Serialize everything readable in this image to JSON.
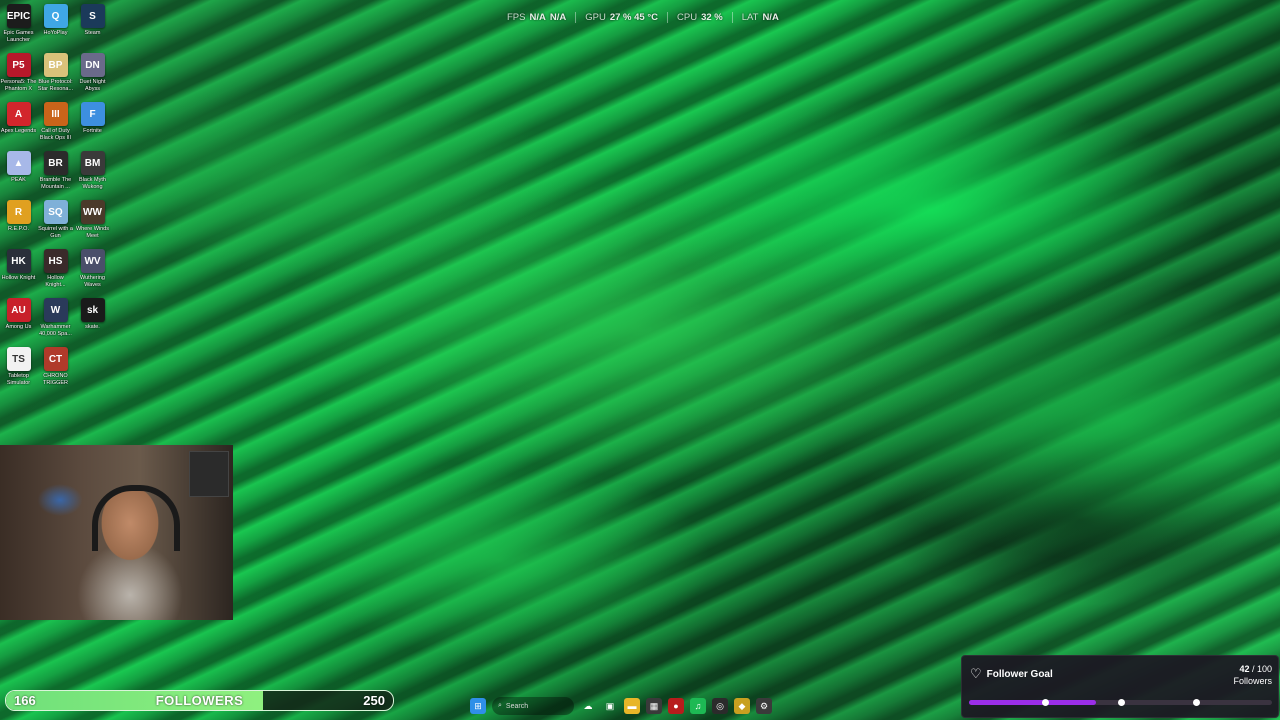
{
  "performance_overlay": {
    "fps_label": "FPS",
    "fps_value": "N/A",
    "fps_value2": "N/A",
    "gpu_label": "GPU",
    "gpu_value": "27 %  45 °C",
    "cpu_label": "CPU",
    "cpu_value": "32 %",
    "lat_label": "LAT",
    "lat_value": "N/A"
  },
  "desktop_icons": [
    {
      "name": "epic-games-launcher-icon",
      "label": "Epic Games Launcher",
      "glyph": "EPIC",
      "color": "#1c1c1c"
    },
    {
      "name": "hoyoplay-icon",
      "label": "HoYoPlay",
      "glyph": "Q",
      "color": "#3fa7e6"
    },
    {
      "name": "steam-icon",
      "label": "Steam",
      "glyph": "S",
      "color": "#1b3a5a"
    },
    {
      "name": "persona5-icon",
      "label": "Persona5: The Phantom X",
      "glyph": "P5",
      "color": "#b8182a"
    },
    {
      "name": "blue-protocol-icon",
      "label": "Blue Protocol: Star Resona...",
      "glyph": "BP",
      "color": "#d9c27a"
    },
    {
      "name": "duet-night-abyss-icon",
      "label": "Duet Night Abyss",
      "glyph": "DN",
      "color": "#6a6a8a"
    },
    {
      "name": "apex-legends-icon",
      "label": "Apex Legends",
      "glyph": "A",
      "color": "#d2262c"
    },
    {
      "name": "call-of-duty-icon",
      "label": "Call of Duty Black Ops III",
      "glyph": "III",
      "color": "#c9641a"
    },
    {
      "name": "fortnite-icon",
      "label": "Fortnite",
      "glyph": "F",
      "color": "#3d8fe0"
    },
    {
      "name": "peak-icon",
      "label": "PEAK",
      "glyph": "▲",
      "color": "#a7b8e8"
    },
    {
      "name": "bramble-icon",
      "label": "Bramble The Mountain ...",
      "glyph": "BR",
      "color": "#2b2b2b"
    },
    {
      "name": "black-myth-wukong-icon",
      "label": "Black Myth Wukong",
      "glyph": "BM",
      "color": "#3a3a3a"
    },
    {
      "name": "repo-icon",
      "label": "R.E.P.O.",
      "glyph": "R",
      "color": "#e0a020"
    },
    {
      "name": "squirrel-with-a-gun-icon",
      "label": "Squirrel with a Gun",
      "glyph": "SQ",
      "color": "#7fb0d8"
    },
    {
      "name": "where-winds-meet-icon",
      "label": "Where Winds Meet",
      "glyph": "WW",
      "color": "#4a3a2a"
    },
    {
      "name": "hollow-knight-icon",
      "label": "Hollow Knight",
      "glyph": "HK",
      "color": "#2a2f3a"
    },
    {
      "name": "hollow-knight-silksong-icon",
      "label": "Hollow Knight...",
      "glyph": "HS",
      "color": "#3a2a2a"
    },
    {
      "name": "wuthering-waves-icon",
      "label": "Wuthering Waves",
      "glyph": "WV",
      "color": "#4a4f6a"
    },
    {
      "name": "among-us-icon",
      "label": "Among Us",
      "glyph": "AU",
      "color": "#c8202a"
    },
    {
      "name": "warhammer-icon",
      "label": "Warhammer 40,000 Spa...",
      "glyph": "W",
      "color": "#2a3a5a"
    },
    {
      "name": "skate-icon",
      "label": "skate.",
      "glyph": "sk",
      "color": "#1a1a1a"
    },
    {
      "name": "tabletop-simulator-icon",
      "label": "Tabletop Simulator",
      "glyph": "TS",
      "color": "#f2f2f2"
    },
    {
      "name": "chrono-trigger-icon",
      "label": "CHRONO TRIGGER",
      "glyph": "CT",
      "color": "#b03a2a"
    }
  ],
  "follower_bar": {
    "current": "166",
    "label": "FOLLOWERS",
    "target": "250",
    "progress": 0.664
  },
  "taskbar": {
    "search_placeholder": "Search",
    "icons": [
      {
        "name": "windows-start-icon",
        "glyph": "⊞",
        "color": "#2f8fe8"
      },
      {
        "name": "search-icon",
        "glyph": "⌕",
        "color": "transparent"
      },
      {
        "name": "weather-icon",
        "glyph": "☁",
        "color": "transparent"
      },
      {
        "name": "task-view-icon",
        "glyph": "▣",
        "color": "transparent"
      },
      {
        "name": "file-explorer-icon",
        "glyph": "▬",
        "color": "#e8b628"
      },
      {
        "name": "store-icon",
        "glyph": "▦",
        "color": "#3a3a3a"
      },
      {
        "name": "record-icon",
        "glyph": "●",
        "color": "#b81c1c"
      },
      {
        "name": "spotify-icon",
        "glyph": "♫",
        "color": "#1db954"
      },
      {
        "name": "obs-icon",
        "glyph": "◎",
        "color": "#2b2b2b"
      },
      {
        "name": "app-icon-yellow",
        "glyph": "◆",
        "color": "#c8a020"
      },
      {
        "name": "steam-taskbar-icon",
        "glyph": "⚙",
        "color": "#3a3a3a"
      }
    ]
  },
  "follower_goal": {
    "title": "Follower Goal",
    "current": "42",
    "target": "100",
    "unit": "Followers",
    "progress": 0.42,
    "accent": "#9b2ee8",
    "markers": [
      0.25,
      0.5,
      0.75
    ]
  }
}
